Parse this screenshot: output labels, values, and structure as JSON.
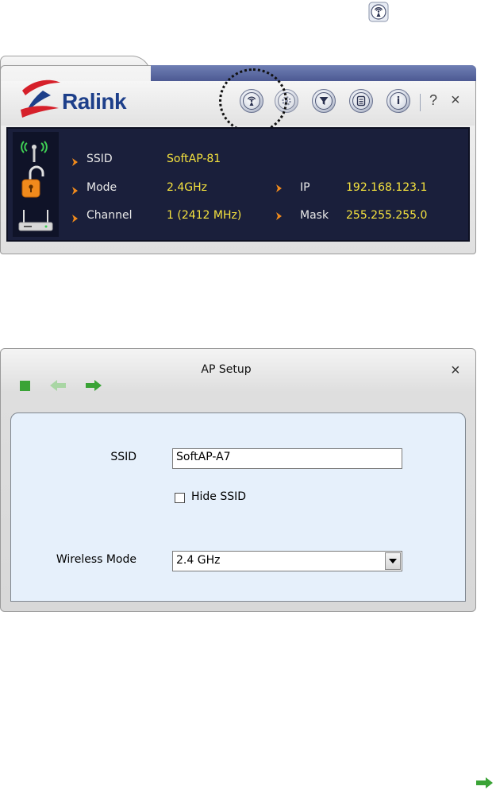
{
  "main_window": {
    "brand": "Ralink",
    "toolbar": {
      "help": "?",
      "close": "×",
      "info_glyph": "i"
    },
    "info": {
      "ssid_label": "SSID",
      "ssid_value": "SoftAP-81",
      "mode_label": "Mode",
      "mode_value": "2.4GHz",
      "channel_label": "Channel",
      "channel_value": "1 (2412 MHz)",
      "ip_label": "IP",
      "ip_value": "192.168.123.1",
      "mask_label": "Mask",
      "mask_value": "255.255.255.0"
    }
  },
  "ap_setup": {
    "title": "AP Setup",
    "close": "×",
    "ssid_label": "SSID",
    "ssid_value": "SoftAP-A7",
    "hide_ssid_label": "Hide SSID",
    "hide_ssid_checked": false,
    "wireless_mode_label": "Wireless Mode",
    "wireless_mode_value": "2.4 GHz"
  },
  "colors": {
    "brand_blue": "#1d3f8a",
    "panel_bg": "#1a1f3b",
    "value_yellow": "#f6e33e",
    "accent_orange": "#f08a1c",
    "green_arrow": "#3aa336",
    "dialog_body": "#e6f0fb"
  },
  "icons": {
    "top": "ap-icon",
    "tool_buttons": [
      "ap-icon",
      "settings-icon",
      "filter-icon",
      "list-icon",
      "info-icon"
    ],
    "status": [
      "signal-antenna-icon",
      "unlocked-padlock-icon",
      "router-icon"
    ],
    "nav": [
      "stop-icon",
      "back-arrow-icon",
      "forward-arrow-icon"
    ],
    "bottom": "forward-arrow-icon"
  }
}
